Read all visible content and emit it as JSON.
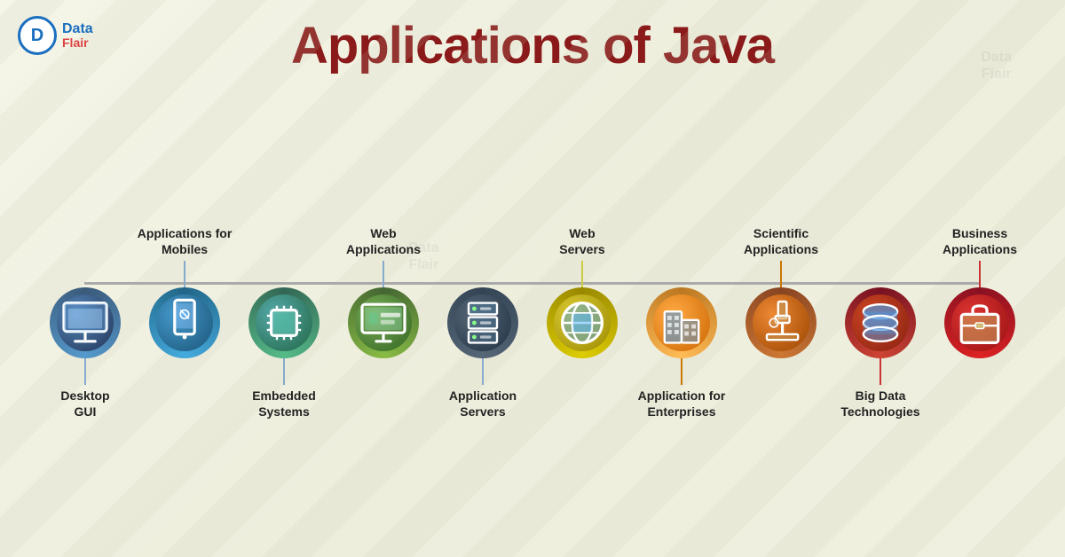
{
  "logo": {
    "text_data": "Data",
    "text_flair": "Flair"
  },
  "title": "Applications of Java",
  "nodes": [
    {
      "id": "desktop-gui",
      "label_top": "",
      "label_bottom": "Desktop\nGUI",
      "ring": "ring-blue-dark",
      "inner": "c-blue-dark",
      "line_color": "blue",
      "icon": "desktop"
    },
    {
      "id": "mobile-apps",
      "label_top": "Applications for\nMobiles",
      "label_bottom": "",
      "ring": "ring-blue",
      "inner": "c-blue",
      "line_color": "blue",
      "icon": "mobile"
    },
    {
      "id": "embedded",
      "label_top": "",
      "label_bottom": "Embedded\nSystems",
      "ring": "ring-teal",
      "inner": "c-teal",
      "line_color": "teal",
      "icon": "chip"
    },
    {
      "id": "web-apps",
      "label_top": "Web\nApplications",
      "label_bottom": "",
      "ring": "ring-green",
      "inner": "c-green",
      "line_color": "green",
      "icon": "monitor"
    },
    {
      "id": "app-servers",
      "label_top": "",
      "label_bottom": "Application\nServers",
      "ring": "ring-dark",
      "inner": "c-dark",
      "line_color": "dark",
      "icon": "server"
    },
    {
      "id": "web-servers",
      "label_top": "Web\nServers",
      "label_bottom": "",
      "ring": "ring-yellow",
      "inner": "c-yellow",
      "line_color": "yellow",
      "icon": "globe"
    },
    {
      "id": "enterprises",
      "label_top": "",
      "label_bottom": "Application for\nEnterprises",
      "ring": "ring-orange-l",
      "inner": "c-orange-light",
      "line_color": "orange",
      "icon": "building"
    },
    {
      "id": "scientific",
      "label_top": "Scientific\nApplications",
      "label_bottom": "",
      "ring": "ring-orange",
      "inner": "c-orange",
      "line_color": "orange",
      "icon": "microscope"
    },
    {
      "id": "bigdata",
      "label_top": "",
      "label_bottom": "Big Data\nTechnologies",
      "ring": "ring-red-dark",
      "inner": "c-red-dark",
      "line_color": "red",
      "icon": "database"
    },
    {
      "id": "business",
      "label_top": "Business\nApplications",
      "label_bottom": "",
      "ring": "ring-red",
      "inner": "c-red",
      "line_color": "red",
      "icon": "briefcase"
    }
  ]
}
